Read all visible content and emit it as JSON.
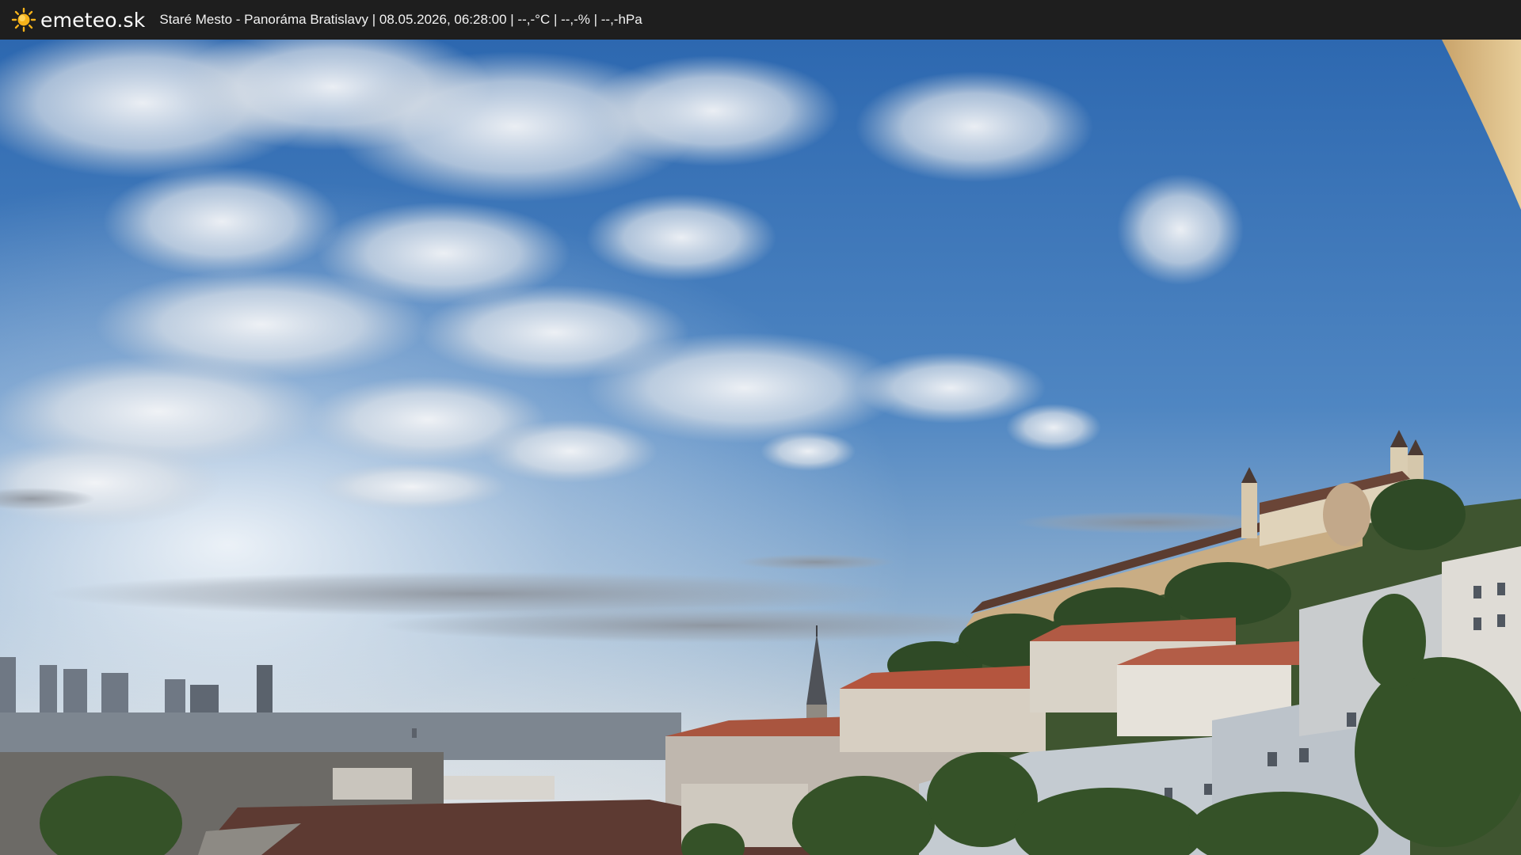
{
  "header": {
    "logo_text": "emeteo.sk",
    "logo_icon": "sun-icon",
    "caption": "Staré Mesto - Panoráma Bratislavy | 08.05.2026, 06:28:00 | --,-°C | --,-% | --,-hPa"
  },
  "colors": {
    "topbar": "#1e1e1e",
    "sun": "#f5b21a",
    "sky_top": "#2f6fb8",
    "sky_horizon": "#d9e2ea"
  }
}
